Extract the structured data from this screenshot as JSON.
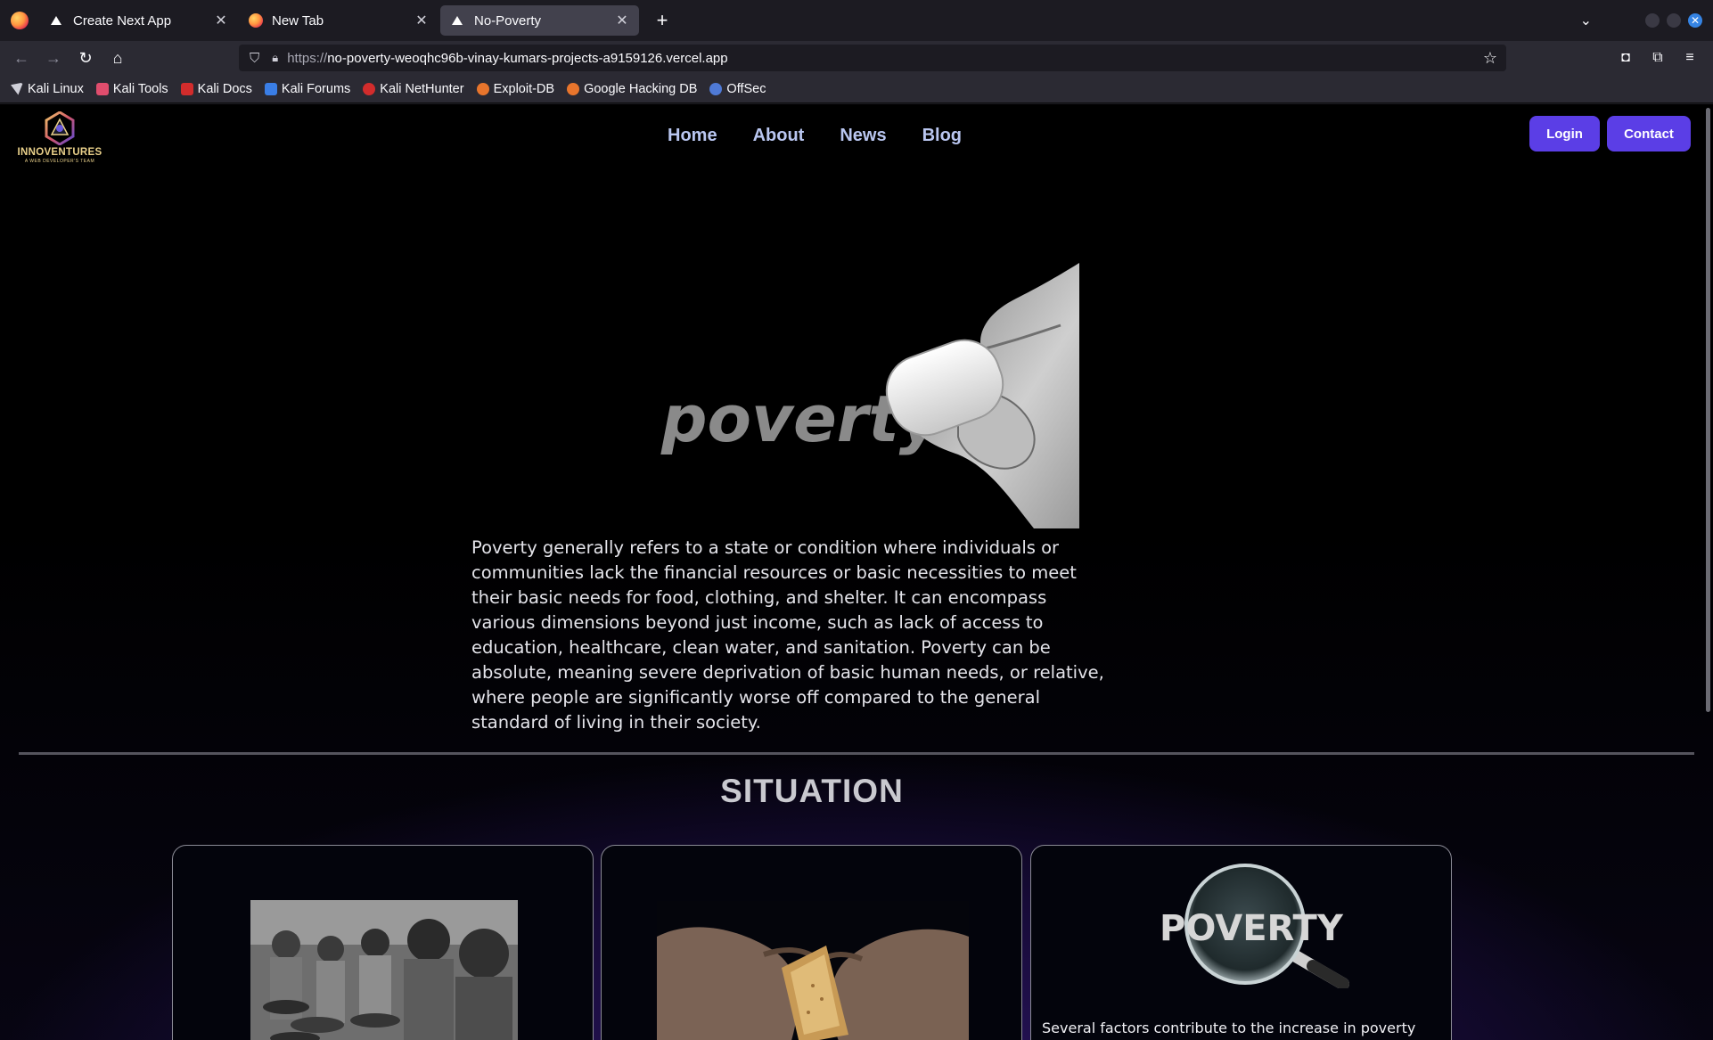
{
  "browser": {
    "tabs": [
      {
        "title": "Create Next App",
        "icon": "vercel-icon",
        "active": false
      },
      {
        "title": "New Tab",
        "icon": "firefox-icon",
        "active": false
      },
      {
        "title": "No-Poverty",
        "icon": "vercel-icon",
        "active": true
      }
    ],
    "url_scheme": "https://",
    "url_rest": "no-poverty-weoqhc96b-vinay-kumars-projects-a9159126.vercel.app",
    "bookmarks": [
      {
        "label": "Kali Linux",
        "color": "#cfcfd8"
      },
      {
        "label": "Kali Tools",
        "color": "#e04d6d"
      },
      {
        "label": "Kali Docs",
        "color": "#d22c2c"
      },
      {
        "label": "Kali Forums",
        "color": "#3a7ee6"
      },
      {
        "label": "Kali NetHunter",
        "color": "#d22c2c"
      },
      {
        "label": "Exploit-DB",
        "color": "#e8752c"
      },
      {
        "label": "Google Hacking DB",
        "color": "#e8752c"
      },
      {
        "label": "OffSec",
        "color": "#4f7ad6"
      }
    ]
  },
  "site": {
    "logo_text": "INNOVENTURES",
    "logo_sub": "A WEB DEVELOPER'S TEAM",
    "nav": [
      "Home",
      "About",
      "News",
      "Blog"
    ],
    "login_label": "Login",
    "contact_label": "Contact",
    "hero_word": "poverty",
    "hero_paragraph": "Poverty generally refers to a state or condition where individuals or communities lack the financial resources or basic necessities to meet their basic needs for food, clothing, and shelter. It can encompass various dimensions beyond just income, such as lack of access to education, healthcare, clean water, and sanitation. Poverty can be absolute, meaning severe deprivation of basic human needs, or relative, where people are significantly worse off compared to the general standard of living in their society.",
    "section_title": "SITUATION",
    "cards": [
      {
        "image": "children-photo",
        "text": ""
      },
      {
        "image": "hands-bread-photo",
        "text": ""
      },
      {
        "image": "magnifier-poverty-image",
        "image_word": "POVERTY",
        "text": "Several factors contribute to the increase in poverty"
      }
    ]
  }
}
